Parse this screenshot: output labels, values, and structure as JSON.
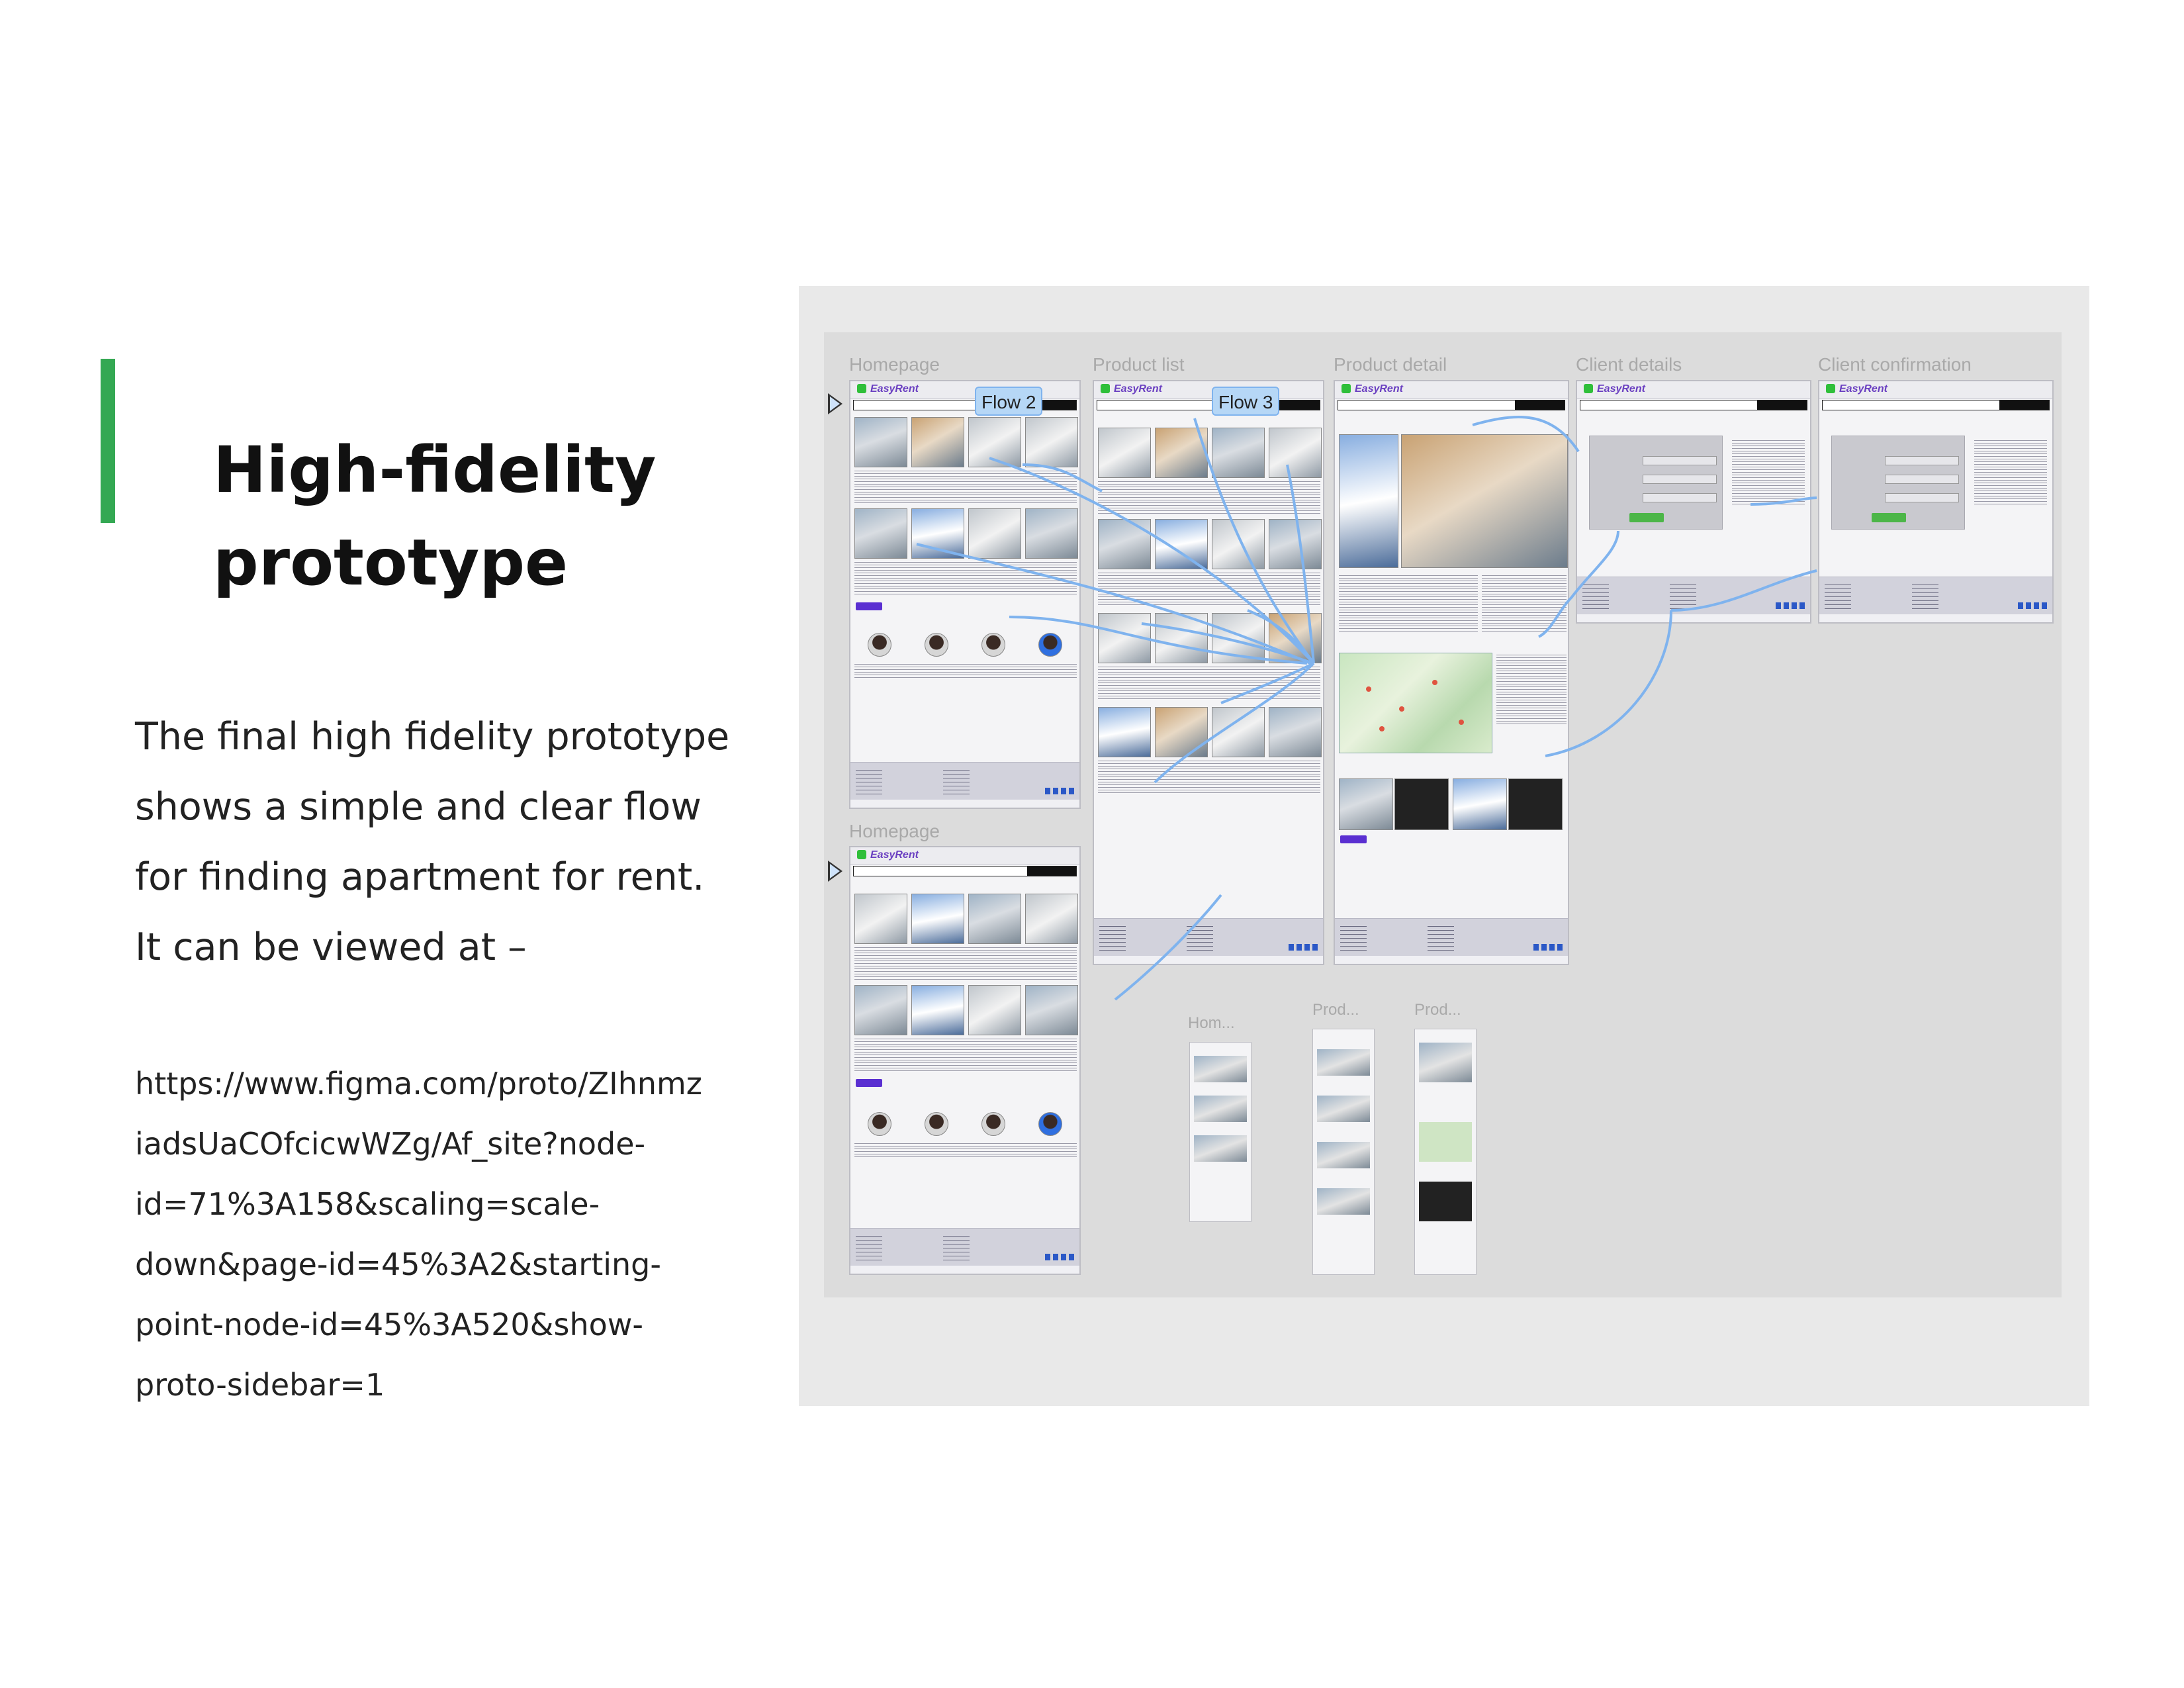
{
  "slide": {
    "title_lines": [
      "High-fidelity",
      "prototype"
    ],
    "body_lines": [
      "The final high fidelity prototype",
      "shows a simple and clear flow",
      "for finding apartment for rent.",
      "It can be viewed at –"
    ],
    "link_lines": [
      "https://www.figma.com/proto/ZIhnmz",
      "iadsUaCOfcicwWZg/Af_site?node-",
      "id=71%3A158&scaling=scale-",
      "down&page-id=45%3A2&starting-",
      "point-node-id=45%3A520&show-",
      "proto-sidebar=1"
    ],
    "accent_color": "#34a853"
  },
  "prototype": {
    "frame_labels": {
      "homepage": "Homepage",
      "product_list": "Product list",
      "product_detail": "Product detail",
      "client_details": "Client details",
      "client_confirmation": "Client confirmation",
      "homepage_2": "Homepage",
      "mini_home": "Hom...",
      "mini_prod_1": "Prod...",
      "mini_prod_2": "Prod..."
    },
    "flow_tags": {
      "flow2": "Flow 2",
      "flow3": "Flow 3"
    },
    "brand": "EasyRent",
    "connector_color": "#7fb3ee",
    "icons": [
      "play-icon",
      "logo-icon",
      "search-bar-icon",
      "social-icons"
    ]
  }
}
